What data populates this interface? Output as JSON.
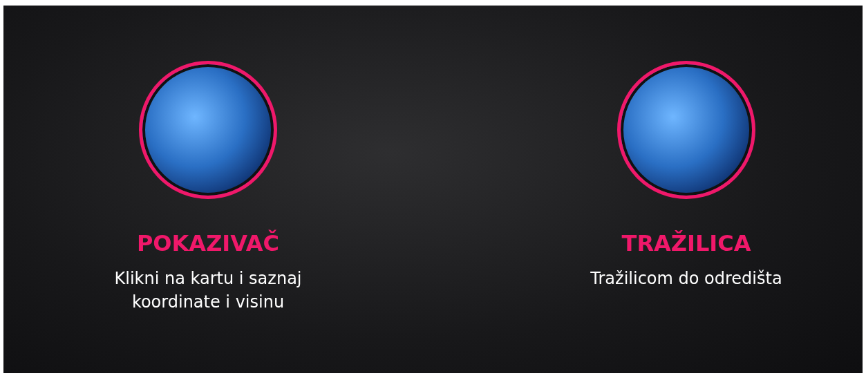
{
  "features": [
    {
      "title": "POKAZIVAČ",
      "description": "Klikni na kartu i saznaj koordinate i visinu"
    },
    {
      "title": "TRAŽILICA",
      "description": "Tražilicom do odredišta"
    }
  ]
}
